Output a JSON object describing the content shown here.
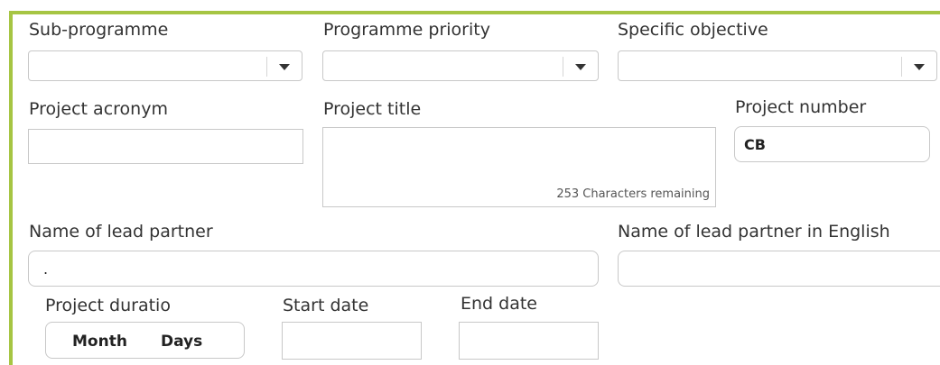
{
  "labels": {
    "sub_programme": "Sub-programme",
    "programme_priority": "Programme priority",
    "specific_objective": "Specific objective",
    "project_acronym": "Project acronym",
    "project_title": "Project title",
    "project_number": "Project number",
    "lead_partner_name": "Name of lead partner",
    "lead_partner_name_en": "Name of lead partner in English",
    "project_duration": "Project duratio",
    "start_date": "Start date",
    "end_date": "End date"
  },
  "values": {
    "project_number": "CB",
    "lead_partner_name": ".",
    "duration_month": "Month",
    "duration_days": "Days"
  },
  "hints": {
    "title_chars_remaining": "253 Characters remaining"
  },
  "icons": {
    "dropdown": "chevron-down-icon"
  },
  "colors": {
    "accent_border": "#a6c543"
  }
}
